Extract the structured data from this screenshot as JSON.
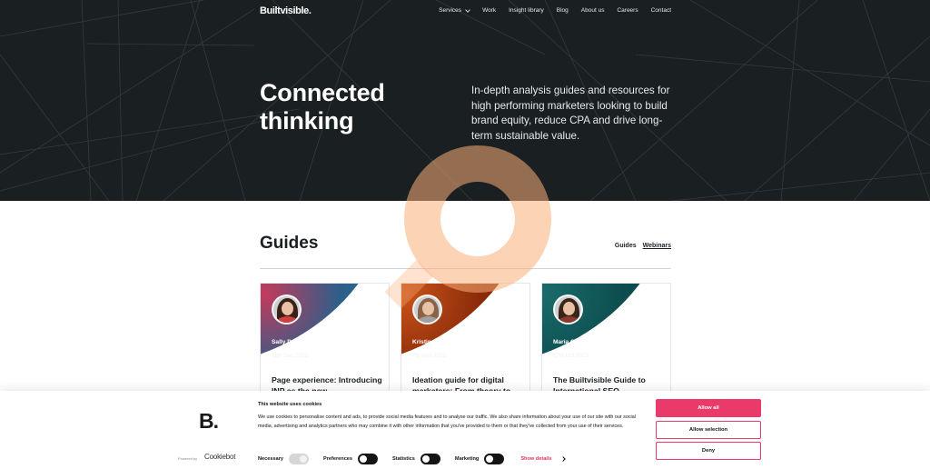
{
  "nav": {
    "logo": "Builtvisible.",
    "items": [
      {
        "label": "Services",
        "has_dropdown": true
      },
      {
        "label": "Work"
      },
      {
        "label": "Insight library"
      },
      {
        "label": "Blog"
      },
      {
        "label": "About us"
      },
      {
        "label": "Careers"
      },
      {
        "label": "Contact"
      }
    ]
  },
  "hero": {
    "title_line1": "Connected",
    "title_line2": "thinking",
    "description": "In-depth analysis guides and resources for high performing marketers looking to build brand equity, reduce CPA and drive long-term sustainable value."
  },
  "section": {
    "title": "Guides",
    "tabs": [
      {
        "label": "Guides",
        "active": true
      },
      {
        "label": "Webinars",
        "active": false
      }
    ]
  },
  "cards": [
    {
      "author": "Sally Poundall",
      "date": "11th Dec 2023",
      "title": "Page experience: Introducing INP as the new",
      "colors": [
        "#2c5f8a",
        "#c43a5c",
        "#1c7f8f"
      ],
      "hair": "#3a2017",
      "shirt": "#d04040"
    },
    {
      "author": "Kristina Lazarevic",
      "date": "7th Nov 2023",
      "title": "Ideation guide for digital marketers: From theory to",
      "colors": [
        "#8a2a0a",
        "#c9541a",
        "#5a1a08"
      ],
      "hair": "#8a6248",
      "shirt": "#a0a0a0"
    },
    {
      "author": "Maria Camanes",
      "date": "17th Oct 2023",
      "title": "The Builtvisible Guide to International SEO",
      "colors": [
        "#0d4d50",
        "#1a6b6a",
        "#0a3d40"
      ],
      "hair": "#3a2418",
      "shirt": "#8a3a30"
    }
  ],
  "cookie_banner": {
    "logo": "B.",
    "powered_by": "Powered by",
    "cookiebot": "Cookiebot",
    "title": "This website uses cookies",
    "body": "We use cookies to personalise content and ads, to provide social media features and to analyse our traffic. We also share information about your use of our site with our social media, advertising and analytics partners who may combine it with other information that you've provided to them or that they've collected from your use of their services.",
    "toggles": [
      {
        "label": "Necessary",
        "state": "on-disabled"
      },
      {
        "label": "Preferences",
        "state": "off"
      },
      {
        "label": "Statistics",
        "state": "off"
      },
      {
        "label": "Marketing",
        "state": "off"
      }
    ],
    "show_details": "Show details",
    "buttons": {
      "allow_all": "Allow all",
      "allow_selection": "Allow selection",
      "deny": "Deny"
    },
    "accent_color": "#e93a6a"
  }
}
